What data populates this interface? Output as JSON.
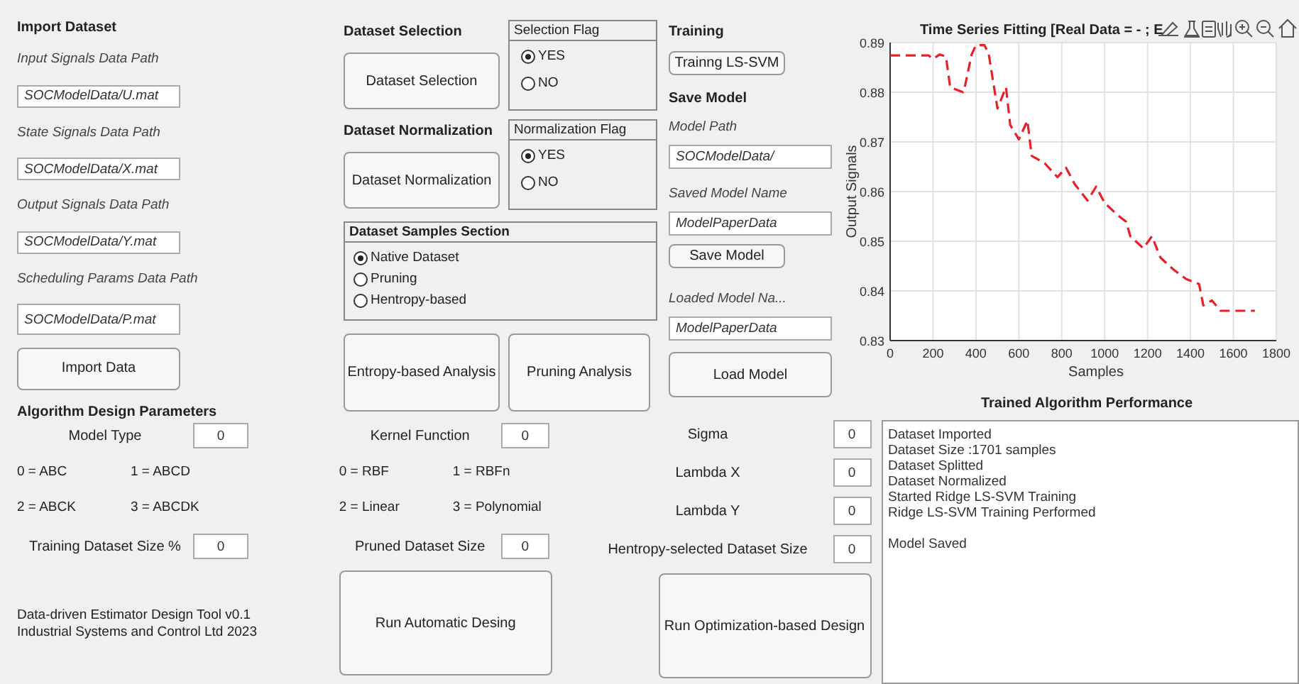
{
  "import_dataset": {
    "title": "Import Dataset",
    "paths": [
      {
        "label": "Input Signals Data Path",
        "value": "SOCModelData/U.mat"
      },
      {
        "label": "State Signals Data Path",
        "value": "SOCModelData/X.mat"
      },
      {
        "label": "Output Signals Data Path",
        "value": "SOCModelData/Y.mat"
      },
      {
        "label": "Scheduling Params Data Path",
        "value": "SOCModelData/P.mat"
      }
    ],
    "button": "Import Data"
  },
  "dataset_selection": {
    "title": "Dataset Selection",
    "button": "Dataset Selection",
    "flag_title": "Selection Flag",
    "options": [
      {
        "label": "YES",
        "selected": true
      },
      {
        "label": "NO",
        "selected": false
      }
    ]
  },
  "dataset_normalization": {
    "title": "Dataset Normalization",
    "button": "Dataset Normalization",
    "flag_title": "Normalization Flag",
    "options": [
      {
        "label": "YES",
        "selected": true
      },
      {
        "label": "NO",
        "selected": false
      }
    ]
  },
  "samples_section": {
    "title": "Dataset  Samples Section",
    "options": [
      {
        "label": "Native Dataset",
        "selected": true
      },
      {
        "label": "Pruning",
        "selected": false
      },
      {
        "label": "Hentropy-based",
        "selected": false
      }
    ]
  },
  "analysis_buttons": [
    "Entropy-based Analysis",
    "Pruning Analysis"
  ],
  "training": {
    "title": "Training",
    "button": "Trainng LS-SVM"
  },
  "save_model": {
    "title": "Save Model",
    "path_label": "Model Path",
    "path_value": "SOCModelData/",
    "name_label": "Saved Model Name",
    "name_value": "ModelPaperData",
    "button": "Save Model",
    "loaded_label": "Loaded Model Na...",
    "loaded_value": "ModelPaperData",
    "load_button": "Load Model"
  },
  "chart": {
    "title": "Time Series Fitting [Real Data = - ; E",
    "chart_data": {
      "type": "line",
      "xlabel": "Samples",
      "ylabel": "Output Signals",
      "xlim": [
        0,
        1800
      ],
      "ylim": [
        0.83,
        0.89
      ],
      "xticks": [
        0,
        200,
        400,
        600,
        800,
        1000,
        1200,
        1400,
        1600,
        1800
      ],
      "grid": true,
      "yticks": [
        0.83,
        0.84,
        0.85,
        0.86,
        0.87,
        0.88,
        0.89
      ],
      "x": [
        0,
        180,
        200,
        230,
        260,
        280,
        340,
        350,
        380,
        400,
        440,
        460,
        500,
        540,
        560,
        600,
        640,
        660,
        720,
        780,
        820,
        860,
        920,
        960,
        1000,
        1060,
        1100,
        1120,
        1180,
        1220,
        1260,
        1320,
        1380,
        1440,
        1460,
        1500,
        1540,
        1700
      ],
      "series": [
        {
          "color": "#e8202a",
          "line_style": "dashed",
          "values": [
            0.8874,
            0.8874,
            0.8867,
            0.8876,
            0.8872,
            0.881,
            0.88,
            0.8815,
            0.8876,
            0.8895,
            0.8895,
            0.8876,
            0.8767,
            0.881,
            0.8734,
            0.8705,
            0.8743,
            0.8672,
            0.8657,
            0.8629,
            0.8648,
            0.8615,
            0.8582,
            0.861,
            0.8577,
            0.8553,
            0.8539,
            0.851,
            0.8486,
            0.851,
            0.8467,
            0.8443,
            0.8424,
            0.8414,
            0.8371,
            0.8381,
            0.836,
            0.836
          ]
        }
      ]
    }
  },
  "performance_title": "Trained Algorithm Performance",
  "log": [
    {
      "text": "Dataset Imported",
      "blank_line_before": false
    },
    {
      "text": "Dataset Size :1701 samples",
      "blank_line_before": false
    },
    {
      "text": "Dataset Splitted",
      "blank_line_before": false
    },
    {
      "text": "Dataset Normalized",
      "blank_line_before": false
    },
    {
      "text": "Started Ridge LS-SVM Training",
      "blank_line_before": false
    },
    {
      "text": "Ridge LS-SVM Training Performed",
      "blank_line_before": false
    },
    {
      "text": "Model Saved",
      "blank_line_before": true
    }
  ],
  "design_parameters": {
    "title": "Algorithm Design Parameters",
    "model_type": {
      "label": "Model Type",
      "value": "0"
    },
    "model_legend": [
      "0 = ABC",
      "1 = ABCD",
      "2 = ABCK",
      "3 = ABCDK"
    ],
    "training_size": {
      "label": "Training Dataset Size %",
      "value": "0"
    },
    "kernel_function": {
      "label": "Kernel Function",
      "value": "0"
    },
    "kernel_legend": [
      "0 = RBF",
      "1 = RBFn",
      "2 = Linear",
      "3 = Polynomial"
    ],
    "pruned_size": {
      "label": "Pruned Dataset Size",
      "value": "0"
    },
    "sigma": {
      "label": "Sigma",
      "value": "0"
    },
    "lambda_x": {
      "label": "Lambda X",
      "value": "0"
    },
    "lambda_y": {
      "label": "Lambda Y",
      "value": "0"
    },
    "hentropy_size": {
      "label": "Hentropy-selected Dataset Size",
      "value": "0"
    }
  },
  "footer": [
    "Data-driven Estimator Design Tool v0.1",
    "Industrial Systems and Control Ltd 2023"
  ],
  "run_buttons": [
    "Run Automatic Desing",
    "Run Optimization-based Design"
  ]
}
